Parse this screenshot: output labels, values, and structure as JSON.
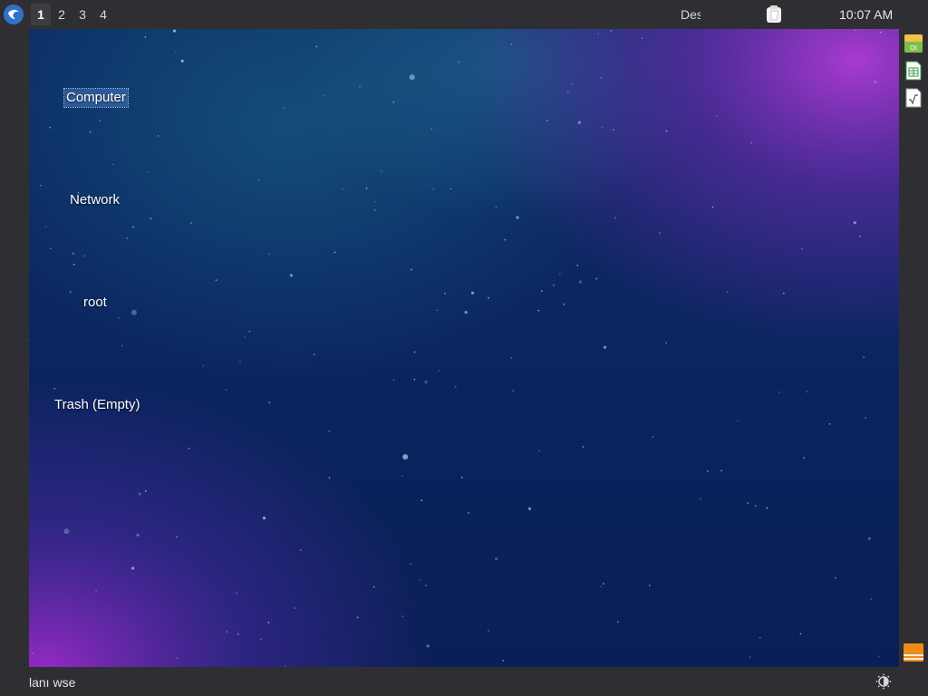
{
  "top_panel": {
    "workspaces": [
      {
        "label": "1",
        "active": true
      },
      {
        "label": "2",
        "active": false
      },
      {
        "label": "3",
        "active": false
      },
      {
        "label": "4",
        "active": false
      }
    ],
    "taskbar_title": "Des",
    "clock": "10:07 AM"
  },
  "desktop": {
    "icons": [
      {
        "label": "Computer",
        "selected": true
      },
      {
        "label": "Network",
        "selected": false
      },
      {
        "label": "root",
        "selected": false
      },
      {
        "label": "Trash (Empty)",
        "selected": false
      }
    ]
  },
  "right_dock": {
    "apps": [
      "qt-project-icon",
      "spreadsheet-icon",
      "formula-document-icon",
      "orange-app-icon"
    ]
  },
  "bottom_panel": {
    "label": "lanı wse"
  },
  "colors": {
    "panel": "#2f2f33",
    "wallpaper_base": "#0b2159",
    "wallpaper_purple": "#8a2bb5",
    "accent_blue": "#2f73c9"
  }
}
